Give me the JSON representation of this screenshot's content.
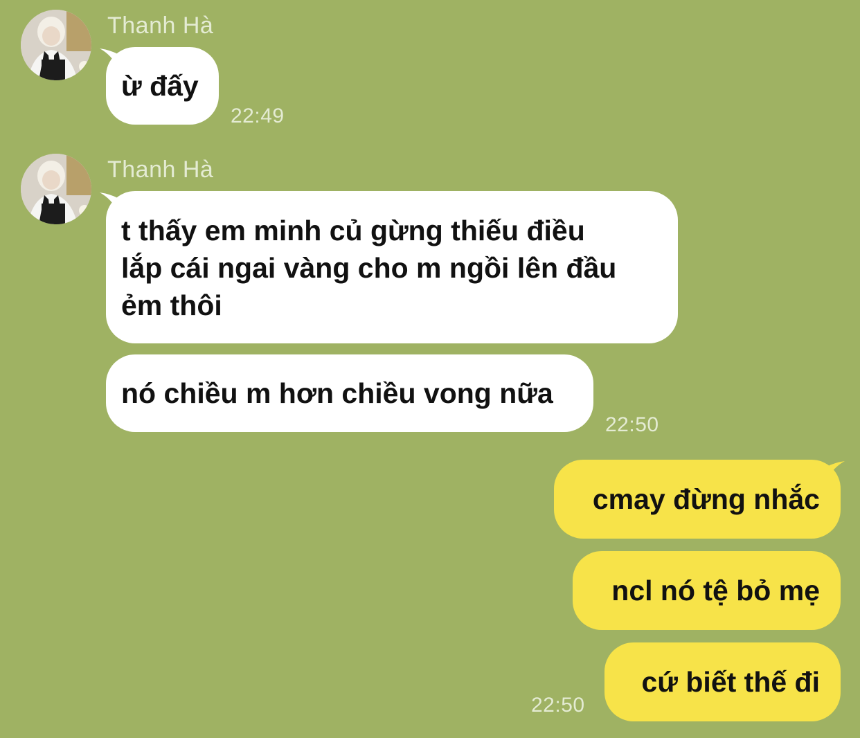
{
  "conversation": {
    "groups": [
      {
        "sender": "Thanh Hà",
        "messages": [
          "ừ đấy"
        ],
        "time": "22:49"
      },
      {
        "sender": "Thanh Hà",
        "messages": [
          "t thấy em minh củ gừng thiếu điều\nlắp cái ngai vàng cho m ngồi lên đầu\nẻm thôi",
          "nó chiều m hơn chiều vong nữa"
        ],
        "time": "22:50"
      },
      {
        "sender": "",
        "messages": [
          "cmay đừng nhắc",
          "ncl nó tệ bỏ mẹ",
          "cứ biết thế đi"
        ],
        "time": "22:50"
      }
    ]
  },
  "colors": {
    "background": "#9fb263",
    "incoming_bubble": "#ffffff",
    "outgoing_bubble": "#f7e349",
    "meta_text": "#e4ebd3"
  },
  "icons": {
    "avatar": "contact-avatar"
  }
}
